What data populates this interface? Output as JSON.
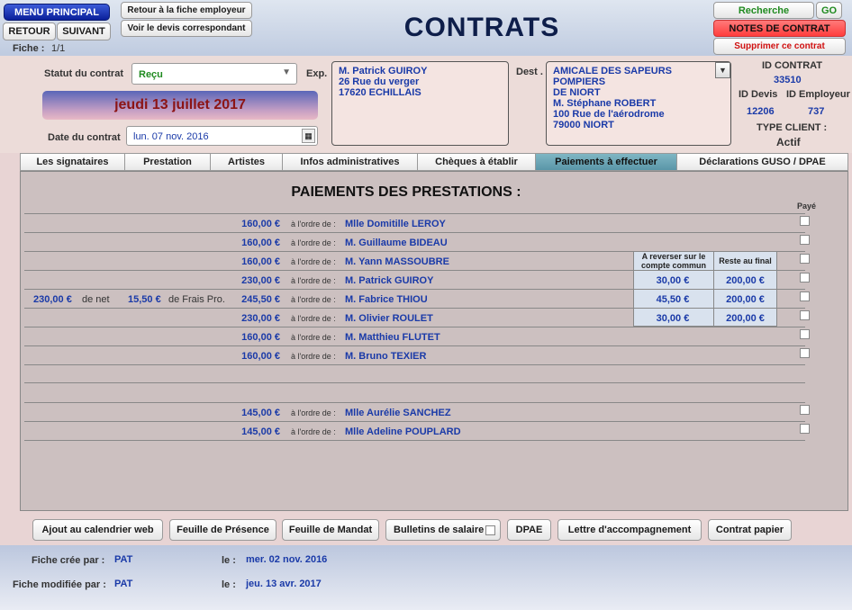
{
  "window": {
    "title": "CONTRATS"
  },
  "nav": {
    "menu_principal": "MENU PRINCIPAL",
    "retour": "RETOUR",
    "suivant": "SUIVANT",
    "retour_fiche": "Retour à la fiche employeur",
    "voir_devis": "Voir le devis correspondant",
    "fiche_label": "Fiche :",
    "fiche_value": "1/1"
  },
  "right_actions": {
    "recherche": "Recherche",
    "go": "GO",
    "notes": "NOTES DE CONTRAT",
    "supprimer": "Supprimer ce contrat"
  },
  "header": {
    "statut_label": "Statut du contrat",
    "statut_value": "Reçu",
    "date_banner": "jeudi 13 juillet 2017",
    "date_contrat_label": "Date du contrat",
    "date_contrat_value": "lun. 07 nov. 2016",
    "exp_label": "Exp.",
    "exp_lines": [
      "M. Patrick GUIROY",
      "26 Rue du verger",
      "17620 ECHILLAIS"
    ],
    "dest_label": "Dest .",
    "dest_lines": [
      "AMICALE DES SAPEURS POMPIERS",
      "DE NIORT",
      "M. Stéphane ROBERT",
      "100 Rue de l'aérodrome",
      "79000 NIORT"
    ],
    "id_contrat_label": "ID CONTRAT",
    "id_contrat_value": "33510",
    "id_devis_label": "ID Devis",
    "id_devis_value": "12206",
    "id_employeur_label": "ID Employeur",
    "id_employeur_value": "737",
    "type_client_label": "TYPE CLIENT :",
    "type_client_value": "Actif"
  },
  "tabs": [
    {
      "label": "Les signataires",
      "active": false
    },
    {
      "label": "Prestation",
      "active": false
    },
    {
      "label": "Artistes",
      "active": false
    },
    {
      "label": "Infos administratives",
      "active": false
    },
    {
      "label": "Chèques à établir",
      "active": false
    },
    {
      "label": "Paiements à effectuer",
      "active": true
    },
    {
      "label": "Déclarations GUSO / DPAE",
      "active": false
    }
  ],
  "payments": {
    "title": "PAIEMENTS DES PRESTATIONS :",
    "paye_header": "Payé",
    "ordre_prefix": "à l'ordre de :",
    "reverser_header": "A reverser sur le compte commun",
    "reste_header": "Reste au final",
    "net_value": "230,00 €",
    "net_suffix": "de net",
    "frais_value": "15,50 €",
    "frais_suffix": "de Frais Pro.",
    "rows": [
      {
        "amount": "160,00 €",
        "name": "Mlle Domitille LEROY"
      },
      {
        "amount": "160,00 €",
        "name": "M. Guillaume BIDEAU"
      },
      {
        "amount": "160,00 €",
        "name": "M. Yann MASSOUBRE"
      },
      {
        "amount": "230,00 €",
        "name": "M. Patrick GUIROY",
        "reverser": "30,00 €",
        "reste": "200,00 €"
      },
      {
        "amount": "245,50 €",
        "name": "M. Fabrice THIOU",
        "reverser": "45,50 €",
        "reste": "200,00 €"
      },
      {
        "amount": "230,00 €",
        "name": "M. Olivier ROULET",
        "reverser": "30,00 €",
        "reste": "200,00 €"
      },
      {
        "amount": "160,00 €",
        "name": "M. Matthieu FLUTET"
      },
      {
        "amount": "160,00 €",
        "name": "M. Bruno TEXIER"
      },
      {
        "amount": "145,00 €",
        "name": "Mlle Aurélie SANCHEZ"
      },
      {
        "amount": "145,00 €",
        "name": "Mlle Adeline POUPLARD"
      }
    ]
  },
  "bottom_buttons": {
    "calendrier": "Ajout au calendrier web",
    "presence": "Feuille de Présence",
    "mandat": "Feuille de Mandat",
    "bulletins": "Bulletins de salaire",
    "dpae": "DPAE",
    "lettre": "Lettre d'accompagnement",
    "contrat_papier": "Contrat papier"
  },
  "footer": {
    "cree_label": "Fiche crée par :",
    "cree_user": "PAT",
    "cree_le": "le :",
    "cree_date": "mer. 02 nov. 2016",
    "modif_label": "Fiche modifiée par :",
    "modif_user": "PAT",
    "modif_le": "le :",
    "modif_date": "jeu. 13 avr. 2017"
  }
}
